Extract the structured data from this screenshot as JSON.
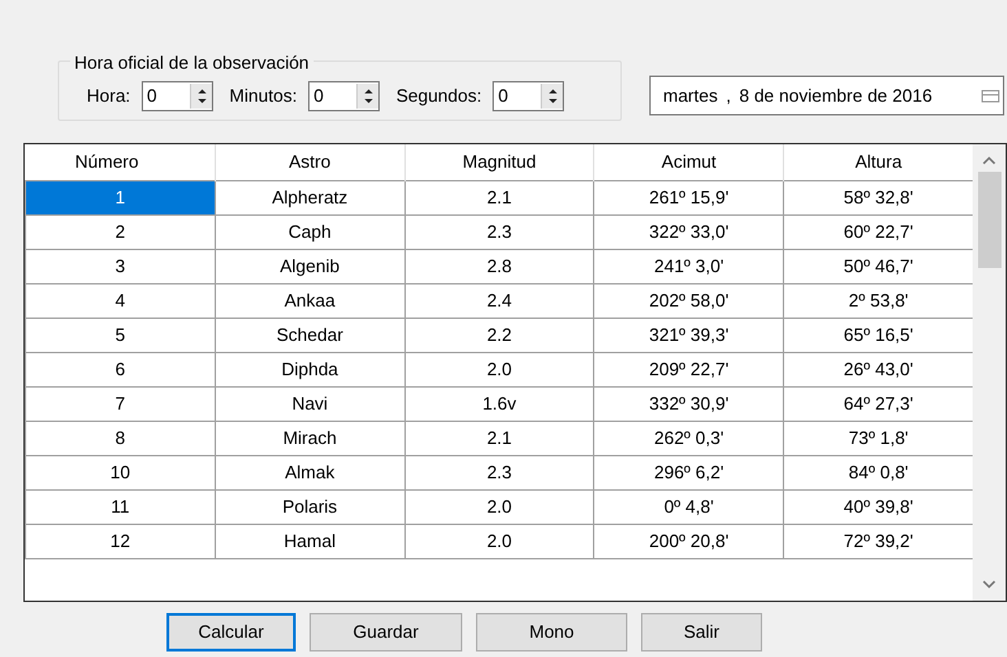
{
  "group": {
    "title": "Hora oficial de la observación",
    "spinners": [
      {
        "label": "Hora:",
        "value": "0"
      },
      {
        "label": "Minutos:",
        "value": "0"
      },
      {
        "label": "Segundos:",
        "value": "0"
      }
    ]
  },
  "date_picker": {
    "weekday": "martes",
    "separator": ",",
    "date": "8 de noviembre de 2016"
  },
  "table": {
    "columns": [
      "Número",
      "Astro",
      "Magnitud",
      "Acimut",
      "Altura"
    ],
    "rows": [
      {
        "cells": [
          "1",
          "Alpheratz",
          "2.1",
          "261º 15,9'",
          "58º 32,8'"
        ],
        "selected": true
      },
      {
        "cells": [
          "2",
          "Caph",
          "2.3",
          "322º 33,0'",
          "60º 22,7'"
        ],
        "selected": false
      },
      {
        "cells": [
          "3",
          "Algenib",
          "2.8",
          "241º 3,0'",
          "50º 46,7'"
        ],
        "selected": false
      },
      {
        "cells": [
          "4",
          "Ankaa",
          "2.4",
          "202º 58,0'",
          "2º 53,8'"
        ],
        "selected": false
      },
      {
        "cells": [
          "5",
          "Schedar",
          "2.2",
          "321º 39,3'",
          "65º 16,5'"
        ],
        "selected": false
      },
      {
        "cells": [
          "6",
          "Diphda",
          "2.0",
          "209º 22,7'",
          "26º 43,0'"
        ],
        "selected": false
      },
      {
        "cells": [
          "7",
          "Navi",
          "1.6v",
          "332º 30,9'",
          "64º 27,3'"
        ],
        "selected": false
      },
      {
        "cells": [
          "8",
          "Mirach",
          "2.1",
          "262º 0,3'",
          "73º 1,8'"
        ],
        "selected": false
      },
      {
        "cells": [
          "10",
          "Almak",
          "2.3",
          "296º 6,2'",
          "84º 0,8'"
        ],
        "selected": false
      },
      {
        "cells": [
          "11",
          "Polaris",
          "2.0",
          "0º 4,8'",
          "40º 39,8'"
        ],
        "selected": false
      },
      {
        "cells": [
          "12",
          "Hamal",
          "2.0",
          "200º 20,8'",
          "72º 39,2'"
        ],
        "selected": false
      }
    ]
  },
  "buttons": [
    {
      "label": "Calcular",
      "focused": true
    },
    {
      "label": "Guardar",
      "focused": false
    },
    {
      "label": "Mono",
      "focused": false
    },
    {
      "label": "Salir",
      "focused": false
    }
  ]
}
